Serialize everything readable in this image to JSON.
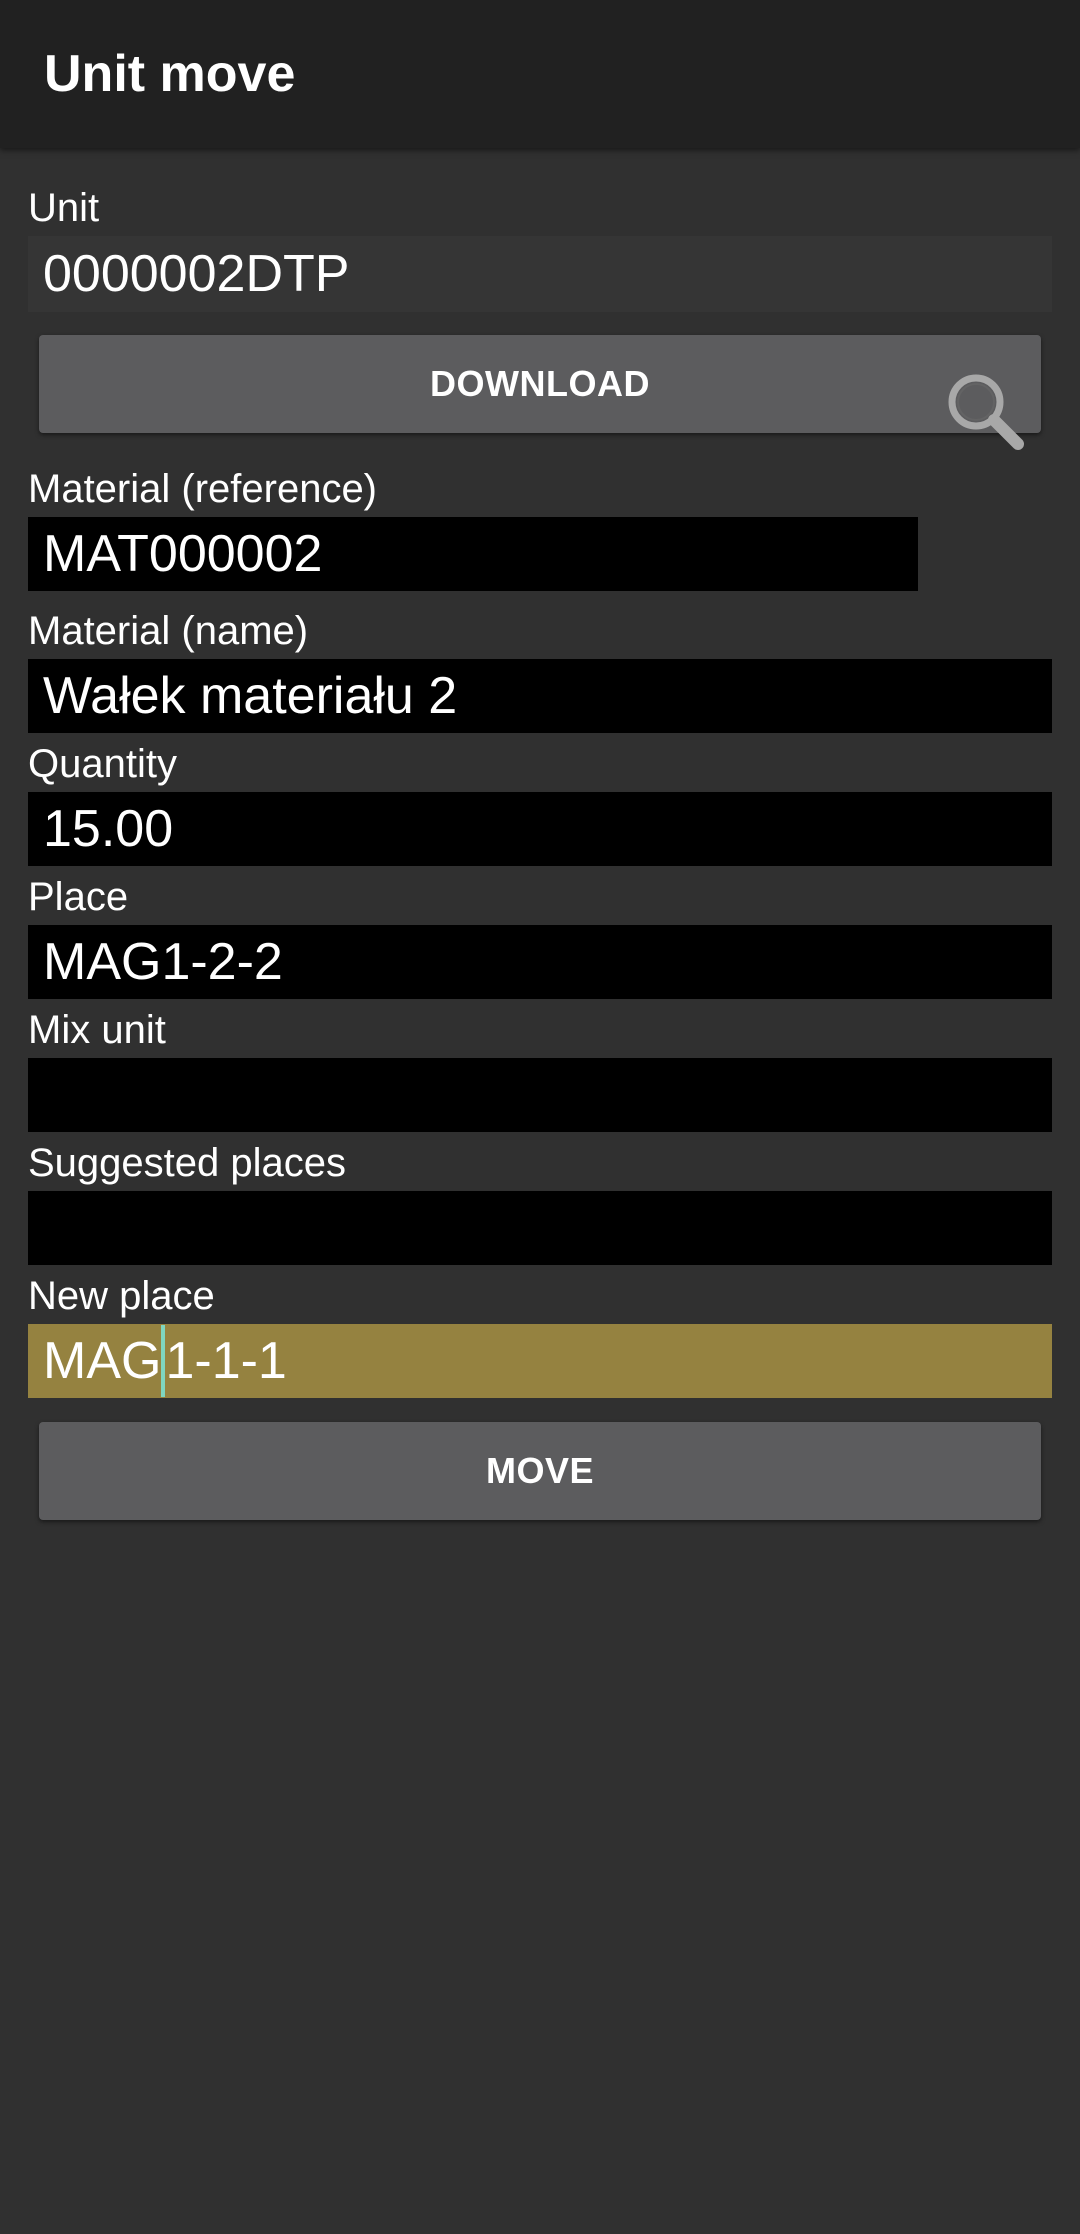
{
  "appbar": {
    "title": "Unit move"
  },
  "unit": {
    "label": "Unit",
    "value": "0000002DTP"
  },
  "download_button": {
    "label": "DOWNLOAD"
  },
  "material_reference": {
    "label": "Material (reference)",
    "value": "MAT000002",
    "search_icon": "search-icon"
  },
  "material_name": {
    "label": "Material (name)",
    "value": "Wałek materiału 2"
  },
  "quantity": {
    "label": "Quantity",
    "value": "15.00"
  },
  "place": {
    "label": "Place",
    "value": "MAG1-2-2"
  },
  "mix_unit": {
    "label": "Mix unit",
    "value": ""
  },
  "suggested_places": {
    "label": "Suggested places",
    "value": ""
  },
  "new_place": {
    "label": "New place",
    "value_before_cursor": "MAG",
    "value_after_cursor": "1-1-1"
  },
  "move_button": {
    "label": "MOVE"
  },
  "colors": {
    "background": "#303030",
    "appbar": "#212121",
    "field": "#000000",
    "active_field": "#958240",
    "button": "#5c5c5e",
    "cursor": "#7fd6c0"
  }
}
